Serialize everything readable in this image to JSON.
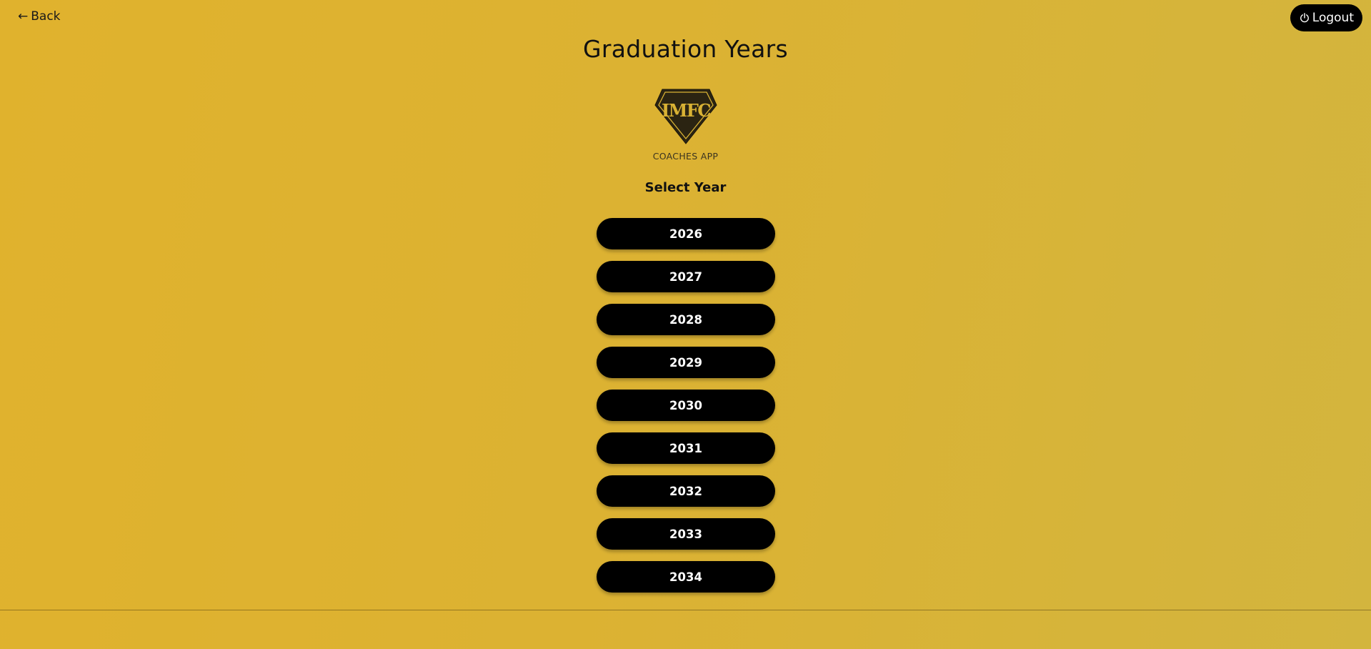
{
  "nav": {
    "back_arrow": "←",
    "back_label": "Back",
    "logout_label": "Logout",
    "logout_icon": "power-icon"
  },
  "header": {
    "title": "Graduation Years",
    "logo_text": "IMFC",
    "subtitle": "COACHES APP"
  },
  "main": {
    "select_label": "Select Year",
    "years": [
      "2026",
      "2027",
      "2028",
      "2029",
      "2030",
      "2031",
      "2032",
      "2033",
      "2034"
    ]
  },
  "colors": {
    "background": "#dcb232",
    "button": "#000000",
    "button_text": "#ffffff"
  }
}
